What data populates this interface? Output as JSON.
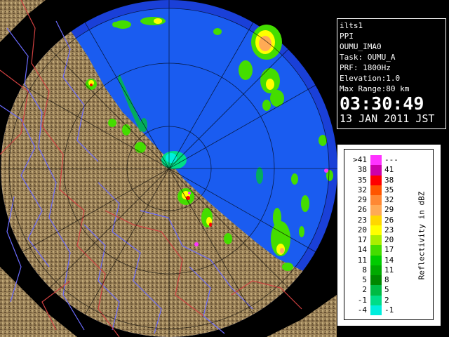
{
  "info": {
    "lines": [
      "ilts1",
      "PPI",
      "OUMU_IMA0",
      "Task: OUMU_A",
      "PRF: 1800Hz",
      "Elevation:1.0",
      "Max Range:80 km"
    ],
    "time": "03:30:49",
    "date": "13 JAN 2011 JST"
  },
  "legend": {
    "unit_label": "Reflectivity in dBZ",
    "rows": [
      {
        "min": ">41",
        "max": "---",
        "color": "#ff33ff"
      },
      {
        "min": "38",
        "max": "41",
        "color": "#cc00aa"
      },
      {
        "min": "35",
        "max": "38",
        "color": "#ff0000"
      },
      {
        "min": "32",
        "max": "35",
        "color": "#ff5500"
      },
      {
        "min": "29",
        "max": "32",
        "color": "#ff8833"
      },
      {
        "min": "26",
        "max": "29",
        "color": "#ffaa55"
      },
      {
        "min": "23",
        "max": "26",
        "color": "#ffd700"
      },
      {
        "min": "20",
        "max": "23",
        "color": "#ffff00"
      },
      {
        "min": "17",
        "max": "20",
        "color": "#aaee00"
      },
      {
        "min": "14",
        "max": "17",
        "color": "#44dd00"
      },
      {
        "min": "11",
        "max": "14",
        "color": "#00cc00"
      },
      {
        "min": "8",
        "max": "11",
        "color": "#00aa00"
      },
      {
        "min": "5",
        "max": "8",
        "color": "#008800"
      },
      {
        "min": "2",
        "max": "5",
        "color": "#00bb44"
      },
      {
        "min": "-1",
        "max": "2",
        "color": "#00dd88"
      },
      {
        "min": "-4",
        "max": "-1",
        "color": "#00eedd"
      }
    ]
  },
  "colors": {
    "radar_fill": "#1a5cf0",
    "outer_ring": "#1a40d8",
    "land": "#9b8258",
    "rivers": "#6b6bff",
    "borders": "#d04040"
  }
}
